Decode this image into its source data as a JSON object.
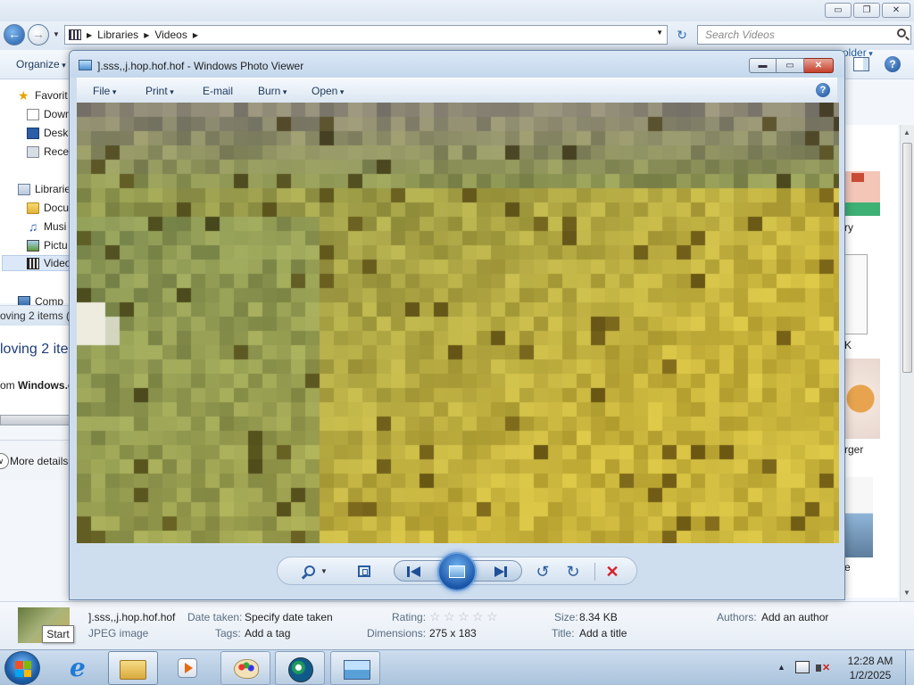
{
  "explorer": {
    "window_controls": {
      "minimize": "▭",
      "restore": "❐",
      "close": "✕"
    },
    "address": {
      "crumbs": [
        "Libraries",
        "Videos"
      ]
    },
    "search_placeholder": "Search Videos",
    "toolbar": {
      "organize": "Organize",
      "folder_option": "older"
    },
    "nav_items": [
      {
        "label": "Favorit",
        "icon": "star-icon"
      },
      {
        "label": "Down",
        "icon": "downloads-icon"
      },
      {
        "label": "Desk",
        "icon": "desktop-icon"
      },
      {
        "label": "Rece",
        "icon": "recent-places-icon"
      },
      {
        "label": "Librarie",
        "icon": "libraries-icon"
      },
      {
        "label": "Docu",
        "icon": "documents-icon"
      },
      {
        "label": "Musi",
        "icon": "music-icon"
      },
      {
        "label": "Pictu",
        "icon": "pictures-icon"
      },
      {
        "label": "Video",
        "icon": "videos-icon"
      },
      {
        "label": "Comp",
        "icon": "computer-icon"
      }
    ],
    "copy_dialog": {
      "title": "oving 2 items (",
      "heading": "loving 2 ite",
      "from_prefix": "om ",
      "from_bold": "Windows.c"
    },
    "more_details": "More details",
    "thumb_labels": [
      "ry",
      "K",
      "rger",
      "e"
    ],
    "details": {
      "filename": "].sss,,j.hop.hof.hof",
      "filetype": "JPEG image",
      "date_taken_label": "Date taken:",
      "date_taken_value": "Specify date taken",
      "tags_label": "Tags:",
      "tags_value": "Add a tag",
      "rating_label": "Rating:",
      "rating_stars": 0,
      "dimensions_label": "Dimensions:",
      "dimensions_value": "275 x 183",
      "size_label": "Size:",
      "size_value": "8.34 KB",
      "title_label": "Title:",
      "title_value": "Add a title",
      "authors_label": "Authors:",
      "authors_value": "Add an author"
    }
  },
  "photo_viewer": {
    "title": "].sss,,j.hop.hof.hof - Windows Photo Viewer",
    "controls": {
      "minimize": "▬",
      "maximize": "▭",
      "close": "✕"
    },
    "menu": [
      {
        "label": "File",
        "dropdown": true
      },
      {
        "label": "Print",
        "dropdown": true
      },
      {
        "label": "E-mail",
        "dropdown": false
      },
      {
        "label": "Burn",
        "dropdown": true
      },
      {
        "label": "Open",
        "dropdown": true
      }
    ],
    "help": "?",
    "bottom_controls": {
      "rotate_left": "↺",
      "rotate_right": "↻",
      "delete": "✕"
    }
  },
  "tooltip": "Start",
  "taskbar": {
    "clock_time": "12:28 AM",
    "clock_date": "1/2/2025"
  },
  "colors": {
    "accent": "#1f5aa6",
    "image_top": "#8a8574",
    "image_mid": "#8d9650",
    "image_bottom": "#c9b43c"
  }
}
